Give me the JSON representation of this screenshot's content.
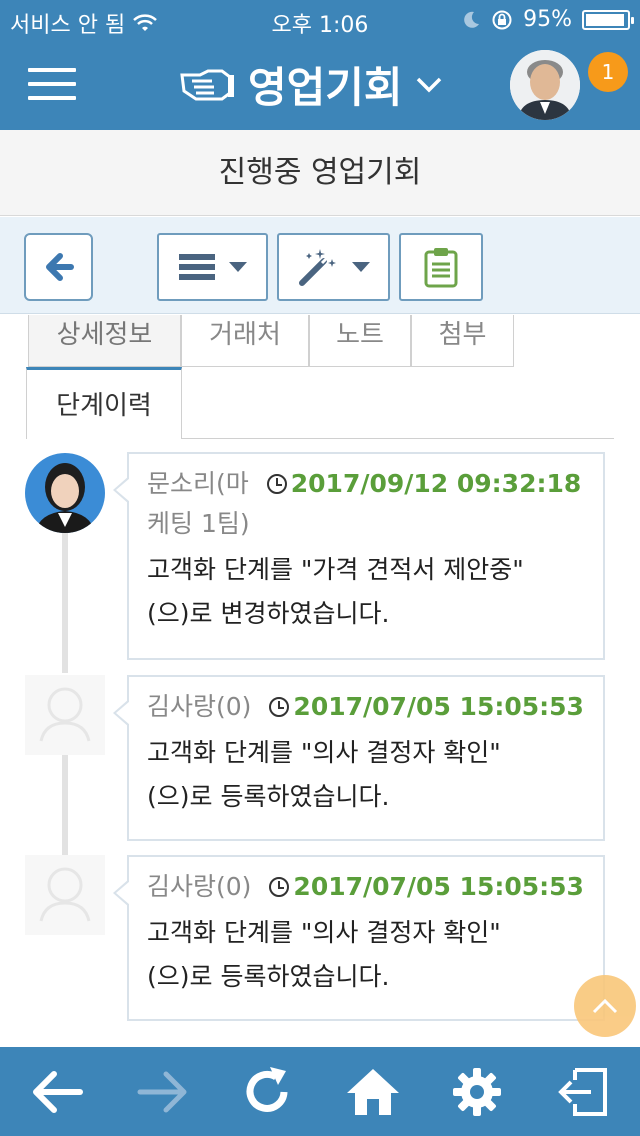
{
  "status_bar": {
    "carrier": "서비스 안 됨",
    "time": "오후 1:06",
    "battery_percent": "95%",
    "battery_level": 0.95
  },
  "header": {
    "title": "영업기회",
    "notification_count": "1"
  },
  "sub_title": "진행중 영업기회",
  "tabs": [
    {
      "label": "상세정보"
    },
    {
      "label": "거래처"
    },
    {
      "label": "노트"
    },
    {
      "label": "첨부"
    },
    {
      "label": "단계이력"
    }
  ],
  "timeline": [
    {
      "author": "문소리(마케팅 1팀)",
      "author_line1": "문소리(마",
      "author_line2": "케팅 1팀)",
      "timestamp": "2017/09/12 09:32:18",
      "message_line1": "고객화 단계를 \"가격 견적서 제안중\"",
      "message_line2": "(으)로 변경하였습니다."
    },
    {
      "author": "김사랑(0)",
      "timestamp": "2017/07/05 15:05:53",
      "message_line1": "고객화 단계를 \"의사 결정자 확인\"",
      "message_line2": "(으)로 등록하였습니다."
    },
    {
      "author": "김사랑(0)",
      "timestamp": "2017/07/05 15:05:53",
      "message_line1": "고객화 단계를 \"의사 결정자 확인\"",
      "message_line2": "(으)로 등록하였습니다."
    }
  ],
  "colors": {
    "brand": "#3d85b8",
    "timestamp": "#5a9e3a",
    "badge": "#f79a1a",
    "scroll_top": "#f9c77a"
  },
  "icons": {
    "menu": "hamburger-icon",
    "title": "handshake-icon",
    "dropdown": "chevron-down-icon",
    "back": "arrow-left-icon",
    "list": "list-dropdown-icon",
    "magic": "magic-wand-icon",
    "clipboard": "clipboard-icon",
    "clock": "clock-icon",
    "nav_back": "arrow-left-icon",
    "nav_forward": "arrow-right-icon",
    "nav_refresh": "refresh-icon",
    "nav_home": "home-icon",
    "nav_settings": "gear-icon",
    "nav_logout": "logout-icon"
  }
}
